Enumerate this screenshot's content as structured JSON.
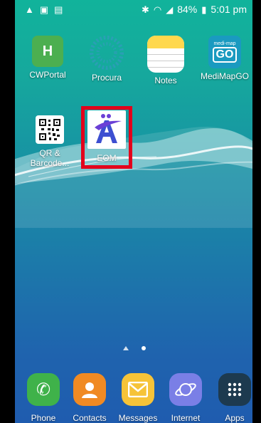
{
  "status_bar": {
    "battery": "84%",
    "time": "5:01 pm"
  },
  "home_apps": [
    {
      "label": "CWPortal",
      "icon": "H"
    },
    {
      "label": "Procura"
    },
    {
      "label": "Notes"
    },
    {
      "label": "MediMapGO",
      "icon": "GO",
      "subtext": "medi-map"
    },
    {
      "label": "QR & Barcode..."
    },
    {
      "label": "EOM",
      "icon": "A"
    }
  ],
  "dock": [
    {
      "label": "Phone"
    },
    {
      "label": "Contacts"
    },
    {
      "label": "Messages"
    },
    {
      "label": "Internet"
    },
    {
      "label": "Apps"
    }
  ],
  "colors": {
    "highlight": "#e3001b",
    "cwportal": "#4caf50",
    "notes": "#ffd84d",
    "medimap": "#1a9ac0",
    "phone": "#3fb24a",
    "contacts": "#f08a23",
    "messages": "#f6c338",
    "internet": "#7a7fe6",
    "apps": "#1d3a4f"
  }
}
